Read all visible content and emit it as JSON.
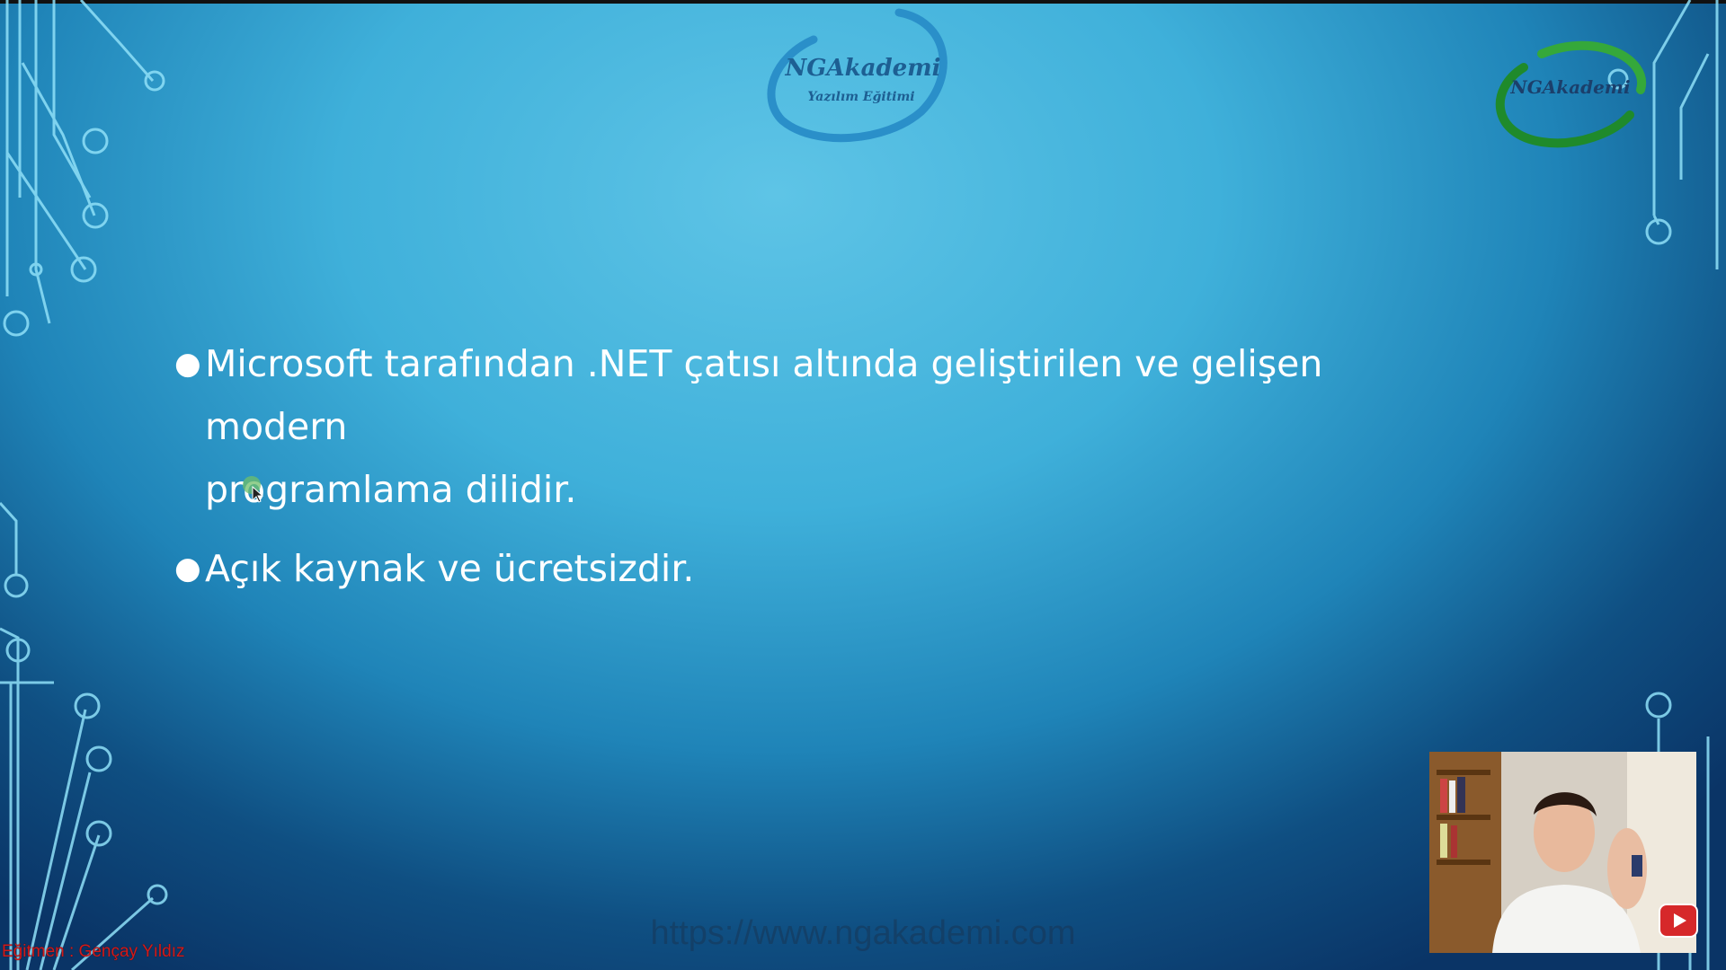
{
  "slide": {
    "bullets": [
      {
        "line1": "Microsoft tarafından .NET çatısı altında geliştirilen ve gelişen modern",
        "line2": "programlama dilidir."
      },
      {
        "line1": "Açık kaynak ve ücretsizdir."
      }
    ]
  },
  "logos": {
    "center_title": "NGAkademi",
    "center_subtitle": "Yazılım Eğitimi",
    "right_title": "NGAkademi"
  },
  "footer": {
    "instructor": "Eğitmen : Gençay Yıldız",
    "watermark_url": "https://www.ngakademi.com"
  },
  "icons": {
    "video": "youtube-play-icon",
    "cursor": "mouse-cursor-icon"
  },
  "colors": {
    "instructor_text": "#d11a1a",
    "background_light": "#5ec4e6",
    "background_dark": "#0a3466"
  }
}
